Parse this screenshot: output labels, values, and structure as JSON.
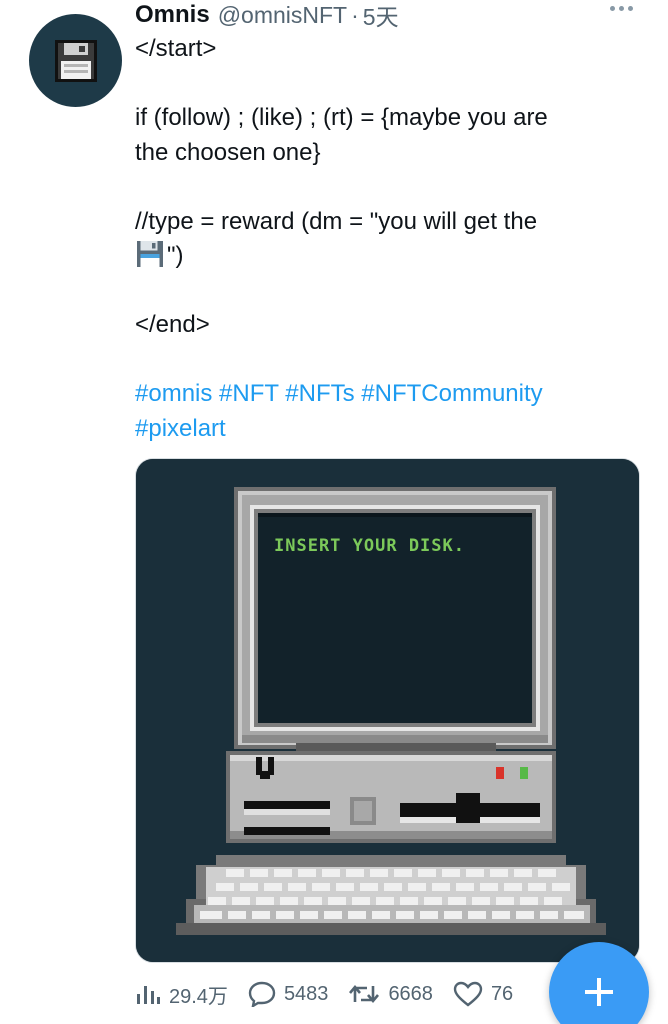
{
  "tweet": {
    "author_name": "Omnis",
    "handle": "@omnisNFT",
    "separator": "·",
    "time": "5天",
    "lines": [
      "</start>",
      "",
      "if (follow) ; (like) ; (rt) = {maybe you are",
      "the choosen one}",
      "",
      "//type = reward (dm = \"you will get the",
      "\")",
      "",
      "</end>",
      ""
    ],
    "hashtag_line1": "#omnis #NFT #NFTs #NFTCommunity",
    "hashtag_line2": "#pixelart",
    "media": {
      "screen_text": "INSERT YOUR DISK.",
      "colors": {
        "background": "#1a2f3a",
        "screen": "#12222a",
        "screen_text": "#7cc95a",
        "bezel": "#a7a7a7",
        "led_red": "#d9342b",
        "led_green": "#57b947"
      }
    },
    "stats": {
      "views": "29.4万",
      "replies": "5483",
      "retweets": "6668",
      "likes": "76"
    }
  },
  "colors": {
    "accent": "#1d9bf0",
    "fab": "#3a9bf5",
    "muted": "#536471"
  },
  "fab_icon": "plus-icon"
}
